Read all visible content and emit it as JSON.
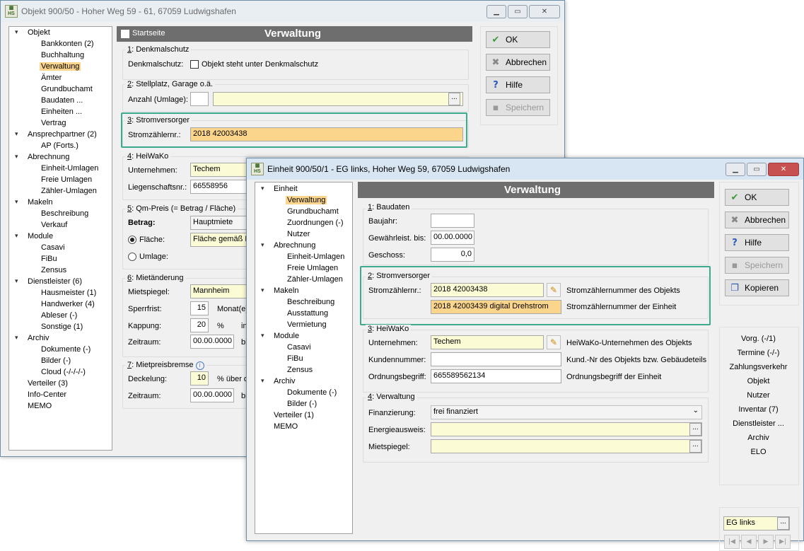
{
  "w1": {
    "title": "Objekt 900/50 - Hoher Weg 59 - 61, 67059 Ludwigshafen",
    "tree": [
      "Objekt",
      "Bankkonten (2)",
      "Buchhaltung",
      "Verwaltung",
      "Ämter",
      "Grundbuchamt",
      "Baudaten ...",
      "Einheiten ...",
      "Vertrag",
      "Ansprechpartner (2)",
      "AP (Forts.)",
      "Abrechnung",
      "Einheit-Umlagen",
      "Freie Umlagen",
      "Zähler-Umlagen",
      "Makeln",
      "Beschreibung",
      "Verkauf",
      "Module",
      "Casavi",
      "FiBu",
      "Zensus",
      "Dienstleister (6)",
      "Hausmeister (1)",
      "Handwerker (4)",
      "Ableser (-)",
      "Sonstige (1)",
      "Archiv",
      "Dokumente (-)",
      "Bilder (-)",
      "Cloud (-/-/-/-)",
      "Verteiler (3)",
      "Info-Center",
      "MEMO"
    ],
    "startseite": "Startseite",
    "header": "Verwaltung",
    "g1_num": "1",
    "g1_title": ": Denkmalschutz",
    "denkmal_label": "Denkmalschutz:",
    "denkmal_cb": "Objekt steht unter Denkmalschutz",
    "g2_num": "2",
    "g2_title": ": Stellplatz, Garage o.ä.",
    "anzahl_label": "Anzahl (Umlage):",
    "g3_num": "3",
    "g3_title": ": Stromversorger",
    "strom_label": "Stromzählernr.:",
    "strom_value": "2018 42003438",
    "g4_num": "4",
    "g4_title": ": HeiWaKo",
    "unternehmen_label": "Unternehmen:",
    "unternehmen_value": "Techem",
    "liegenschaft_label": "Liegenschaftsnr.:",
    "liegenschaft_value": "66558956",
    "g5_num": "5",
    "g5_title": ": Qm-Preis (= Betrag / Fläche)",
    "betrag_label": "Betrag:",
    "betrag_value": "Hauptmiete",
    "flaeche_label": "Fläche:",
    "flaeche_value": "Fläche gemäß E",
    "umlage_label": "Umlage:",
    "g6_num": "6",
    "g6_title": ": Mietänderung",
    "mietspiegel_label": "Mietspiegel:",
    "mietspiegel_value": "Mannheim",
    "sperrfrist_label": "Sperrfrist:",
    "sperrfrist_value": "15",
    "sperrfrist_unit": "Monat(e)",
    "kappung_label": "Kappung:",
    "kappung_value": "20",
    "kappung_unit": "%",
    "kappung_suffix": "in",
    "zeitraum_label": "Zeitraum:",
    "zeitraum_value": "00.00.0000",
    "zeitraum_suffix": "bi",
    "g7_num": "7",
    "g7_title": ": Mietpreisbremse",
    "deckelung_label": "Deckelung:",
    "deckelung_value": "10",
    "deckelung_unit": "% über de",
    "zeitraum2_label": "Zeitraum:",
    "zeitraum2_value": "00.00.0000",
    "zeitraum2_suffix": "bi",
    "buttons": {
      "ok": "OK",
      "abbrechen": "Abbrechen",
      "hilfe": "Hilfe",
      "speichern": "Speichern"
    }
  },
  "w2": {
    "title": "Einheit 900/50/1 - EG links, Hoher Weg 59, 67059 Ludwigshafen",
    "tree": [
      "Einheit",
      "Verwaltung",
      "Grundbuchamt",
      "Zuordnungen (-)",
      "Nutzer",
      "Abrechnung",
      "Einheit-Umlagen",
      "Freie Umlagen",
      "Zähler-Umlagen",
      "Makeln",
      "Beschreibung",
      "Ausstattung",
      "Vermietung",
      "Module",
      "Casavi",
      "FiBu",
      "Zensus",
      "Archiv",
      "Dokumente (-)",
      "Bilder (-)",
      "Verteiler (1)",
      "MEMO"
    ],
    "header": "Verwaltung",
    "g1_num": "1",
    "g1_title": ": Baudaten",
    "baujahr_label": "Baujahr:",
    "gewaehr_label": "Gewährleist. bis:",
    "gewaehr_value": "00.00.0000",
    "geschoss_label": "Geschoss:",
    "geschoss_value": "0,0",
    "g2_num": "2",
    "g2_title": ": Stromversorger",
    "strom_label": "Stromzählernr.:",
    "strom_obj": "2018 42003438",
    "strom_obj_desc": "Stromzählernummer des Objekts",
    "strom_einh": "2018 42003439 digital Drehstrom",
    "strom_einh_desc": "Stromzählernummer der Einheit",
    "g3_num": "3",
    "g3_title": ": HeiWaKo",
    "unternehmen_label": "Unternehmen:",
    "unternehmen_value": "Techem",
    "unternehmen_desc": "HeiWaKo-Unternehmen des Objekts",
    "kunden_label": "Kundennummer:",
    "kunden_desc": "Kund.-Nr des Objekts bzw. Gebäudeteils",
    "ordnung_label": "Ordnungsbegriff:",
    "ordnung_value": "665589562134",
    "ordnung_desc": "Ordnungsbegriff der Einheit",
    "g4_num": "4",
    "g4_title": ": Verwaltung",
    "finanz_label": "Finanzierung:",
    "finanz_value": "frei finanziert",
    "energie_label": "Energieausweis:",
    "mietspiegel_label": "Mietspiegel:",
    "buttons": {
      "ok": "OK",
      "abbrechen": "Abbrechen",
      "hilfe": "Hilfe",
      "speichern": "Speichern",
      "kopieren": "Kopieren"
    },
    "links": [
      "Vorg. (-/1)",
      "Termine (-/-)",
      "Zahlungsverkehr",
      "Objekt",
      "Nutzer",
      "Inventar (7)",
      "Dienstleister ...",
      "Archiv",
      "ELO"
    ],
    "nav_value": "EG links"
  }
}
